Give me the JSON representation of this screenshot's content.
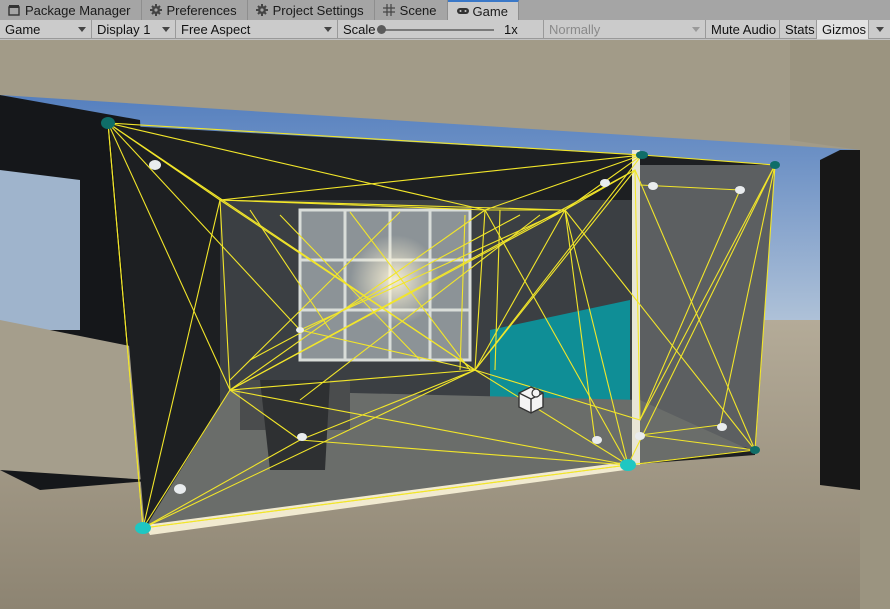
{
  "tabs": [
    {
      "label": "Package Manager",
      "icon": "package-icon",
      "active": false
    },
    {
      "label": "Preferences",
      "icon": "gear-icon",
      "active": false
    },
    {
      "label": "Project Settings",
      "icon": "gear-icon",
      "active": false
    },
    {
      "label": "Scene",
      "icon": "grid-icon",
      "active": false
    },
    {
      "label": "Game",
      "icon": "gamepad-icon",
      "active": true
    }
  ],
  "toolbar": {
    "view_mode": "Game",
    "display": "Display 1",
    "aspect": "Free Aspect",
    "scale_label": "Scale",
    "scale_value": "1x",
    "play_mode": "Normally",
    "mute_audio": "Mute Audio",
    "stats": "Stats",
    "gizmos": "Gizmos"
  },
  "colors": {
    "gizmo_lines": "#f2e62a",
    "probe_nodes": "#1fc7c2",
    "active_tab_accent": "#3a78c8",
    "sky": "#5b86c8",
    "ground": "#a9a08e"
  }
}
